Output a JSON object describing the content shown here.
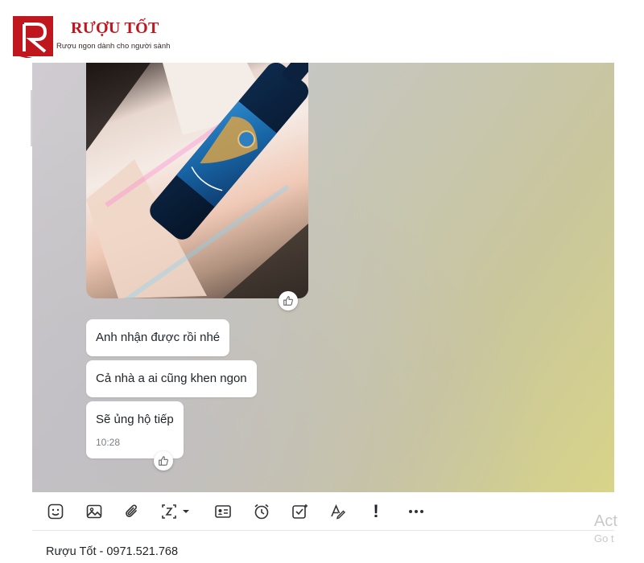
{
  "brand": {
    "name": "RƯỢU TỐT",
    "tagline": "Rượu ngon dành cho người sành",
    "logo_letter": "R",
    "color": "#c0161d"
  },
  "chat": {
    "photo_icon": "wine-bottle-photo",
    "messages": [
      {
        "text": "Anh nhận được rồi nhé"
      },
      {
        "text": "Cả nhà a ai cũng khen ngon"
      },
      {
        "text": "Sẽ ủng hộ tiếp",
        "time": "10:28"
      }
    ],
    "reaction_icon": "thumbs-up-icon"
  },
  "toolbar": {
    "icons": [
      "sticker-icon",
      "image-icon",
      "attachment-icon",
      "screenshot-icon",
      "contact-card-icon",
      "reminder-clock-icon",
      "task-check-icon",
      "format-text-icon",
      "important-icon",
      "more-icon"
    ],
    "important_label": "!",
    "more_label": "•••"
  },
  "watermark": {
    "line1": "Act",
    "line2": "Go t"
  },
  "footer": {
    "text": "Rượu Tốt - 0971.521.768"
  }
}
